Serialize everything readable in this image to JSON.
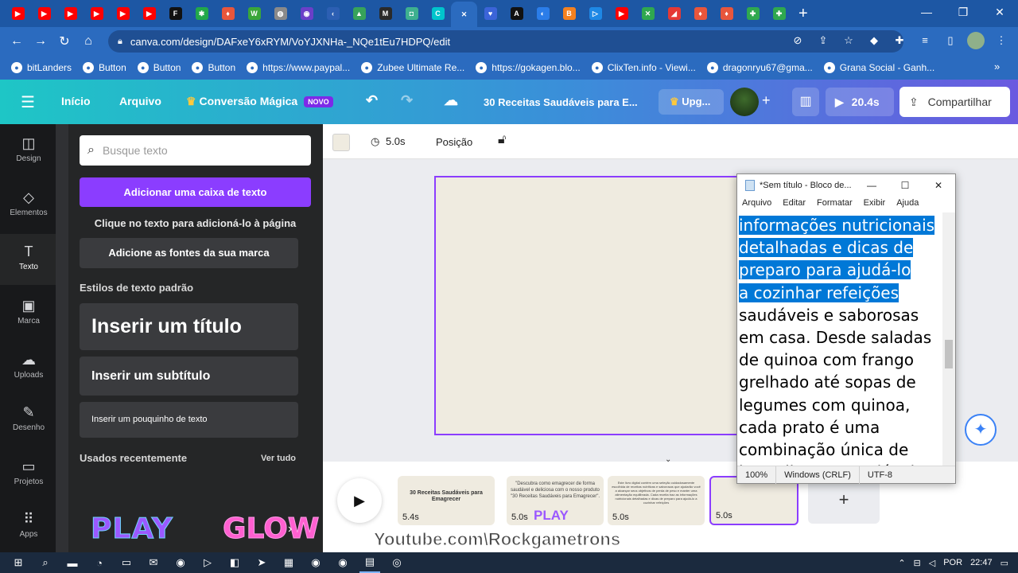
{
  "browser": {
    "tabs": [
      {
        "icon": "youtube-icon",
        "color": "#ff0000",
        "glyph": "▶"
      },
      {
        "icon": "youtube-icon",
        "color": "#ff0000",
        "glyph": "▶"
      },
      {
        "icon": "youtube-icon",
        "color": "#ff0000",
        "glyph": "▶"
      },
      {
        "icon": "youtube-icon",
        "color": "#ff0000",
        "glyph": "▶"
      },
      {
        "icon": "youtube-icon",
        "color": "#ff0000",
        "glyph": "▶"
      },
      {
        "icon": "youtube-icon",
        "color": "#ff0000",
        "glyph": "▶"
      },
      {
        "icon": "f-app-icon",
        "color": "#111111",
        "glyph": "F"
      },
      {
        "icon": "pinwheel-icon",
        "color": "#22a84a",
        "glyph": "✱"
      },
      {
        "icon": "drop-icon",
        "color": "#e8563c",
        "glyph": "♦"
      },
      {
        "icon": "w-app-icon",
        "color": "#3aa63a",
        "glyph": "W"
      },
      {
        "icon": "globe-icon",
        "color": "#8a8a8a",
        "glyph": "◍"
      },
      {
        "icon": "purple-circle-icon",
        "color": "#6b3fc8",
        "glyph": "◉"
      },
      {
        "icon": "arrow-app-icon",
        "color": "#2c5fb3",
        "glyph": "‹"
      },
      {
        "icon": "triangle-icon",
        "color": "#37a35a",
        "glyph": "▲"
      },
      {
        "icon": "m-app-icon",
        "color": "#2a2a2a",
        "glyph": "M"
      },
      {
        "icon": "rounded-app-icon",
        "color": "#3eb08f",
        "glyph": "◘"
      },
      {
        "icon": "canva-icon",
        "color": "#00c4cc",
        "glyph": "C"
      },
      {
        "icon": "close-icon",
        "color": "#2b6bbf",
        "glyph": "✕"
      },
      {
        "icon": "heart-app-icon",
        "color": "#3b64d8",
        "glyph": "♥"
      },
      {
        "icon": "a-app-icon",
        "color": "#111111",
        "glyph": "A"
      },
      {
        "icon": "half-circle-icon",
        "color": "#2b7de9",
        "glyph": "◐"
      },
      {
        "icon": "blogger-icon",
        "color": "#f48120",
        "glyph": "B"
      },
      {
        "icon": "play-app-icon",
        "color": "#1e88e5",
        "glyph": "▷"
      },
      {
        "icon": "youtube-icon",
        "color": "#ff0000",
        "glyph": "▶"
      },
      {
        "icon": "x-app-icon",
        "color": "#2fa84f",
        "glyph": "✕"
      },
      {
        "icon": "shield-app-icon",
        "color": "#e53935",
        "glyph": "◢"
      },
      {
        "icon": "drop-icon",
        "color": "#e8563c",
        "glyph": "♦"
      },
      {
        "icon": "drop-icon",
        "color": "#e8563c",
        "glyph": "♦"
      },
      {
        "icon": "puzzle-icon",
        "color": "#2fa84f",
        "glyph": "✚"
      },
      {
        "icon": "puzzle-icon",
        "color": "#2fa84f",
        "glyph": "✚"
      }
    ],
    "new_tab": "+",
    "url": "canva.com/design/DAFxeY6xRYM/VoYJXNHa-_NQe1tEu7HDPQ/edit",
    "bookmarks": [
      {
        "label": "bitLanders",
        "icon": "globe-icon"
      },
      {
        "label": "Button",
        "icon": "globe-icon"
      },
      {
        "label": "Button",
        "icon": "globe-icon"
      },
      {
        "label": "Button",
        "icon": "globe-icon"
      },
      {
        "label": "https://www.paypal...",
        "icon": "paypal-icon"
      },
      {
        "label": "Zubee Ultimate Re...",
        "icon": "zubee-icon"
      },
      {
        "label": "https://gokagen.blo...",
        "icon": "blogger-icon"
      },
      {
        "label": "ClixTen.info - Viewi...",
        "icon": "clixten-icon"
      },
      {
        "label": "dragonryu67@gma...",
        "icon": "google-icon"
      },
      {
        "label": "Grana Social - Ganh...",
        "icon": "grana-icon"
      }
    ]
  },
  "canva": {
    "header": {
      "home": "Início",
      "file": "Arquivo",
      "magic": "Conversão Mágica",
      "new_badge": "NOVO",
      "title": "30 Receitas Saudáveis para E...",
      "upgrade": "Upg...",
      "play_time": "20.4s",
      "share": "Compartilhar"
    },
    "rail": [
      {
        "label": "Design",
        "icon": "design-icon",
        "glyph": "◫"
      },
      {
        "label": "Elementos",
        "icon": "elements-icon",
        "glyph": "◇"
      },
      {
        "label": "Texto",
        "icon": "text-icon",
        "glyph": "T"
      },
      {
        "label": "Marca",
        "icon": "brand-icon",
        "glyph": "▣"
      },
      {
        "label": "Uploads",
        "icon": "upload-icon",
        "glyph": "☁"
      },
      {
        "label": "Desenho",
        "icon": "draw-icon",
        "glyph": "✎"
      },
      {
        "label": "Projetos",
        "icon": "folder-icon",
        "glyph": "▭"
      },
      {
        "label": "Apps",
        "icon": "apps-icon",
        "glyph": "⠿"
      }
    ],
    "panel": {
      "search_placeholder": "Busque texto",
      "add_textbox": "Adicionar uma caixa de texto",
      "hint": "Clique no texto para adicioná-lo à página",
      "brand_fonts": "Adicione as fontes da sua marca",
      "default_styles": "Estilos de texto padrão",
      "heading": "Inserir um título",
      "subheading": "Inserir um subtítulo",
      "body": "Inserir um pouquinho de texto",
      "recent": "Usados recentemente",
      "see_all": "Ver tudo",
      "recent_items": [
        "PLAY",
        "GLOW"
      ]
    },
    "toolbar": {
      "duration": "5.0s",
      "position": "Posição"
    },
    "timeline": {
      "pages": [
        {
          "duration": "5.4s",
          "text": "30 Receitas Saudáveis para Emagrecer"
        },
        {
          "duration": "5.0s",
          "text": "\"Descubra como emagrecer de forma saudável e deliciosa com o nosso produto \"30 Receitas Saudáveis para Emagrecer\".",
          "badge": "PLAY"
        },
        {
          "duration": "5.0s",
          "text": "Este livro digital contém uma seleção cuidadosamente escolhida de receitas nutritivas e saborosas que ajudarão você a alcançar seus objetivos de perda de peso e manter uma alimentação equilibrada. Cada receita traz as informações nutricionais detalhadas e dicas de preparo para ajudá-lo a cozinhar refeições"
        },
        {
          "duration": "5.0s",
          "text": ""
        }
      ],
      "add_page": "+"
    },
    "watermark": "Youtube.com\\Rockgametrons"
  },
  "notepad": {
    "title": "*Sem título - Bloco de...",
    "menu": [
      "Arquivo",
      "Editar",
      "Formatar",
      "Exibir",
      "Ajuda"
    ],
    "selected_text": [
      "informações nutricionais",
      "detalhadas e dicas de",
      "preparo para ajudá-lo",
      "a cozinhar refeições"
    ],
    "text_lines": [
      "saudáveis e saborosas",
      "em casa. Desde saladas",
      "de quinoa com frango",
      "grelhado até sopas de",
      "legumes com quinoa,",
      "cada prato é uma",
      "combinação única de",
      "ingredientes saudáveis e"
    ],
    "zoom": "100%",
    "line_endings": "Windows (CRLF)",
    "encoding": "UTF-8"
  },
  "taskbar": {
    "apps": [
      {
        "icon": "windows-start-icon",
        "glyph": "⊞"
      },
      {
        "icon": "search-icon",
        "glyph": "⌕"
      },
      {
        "icon": "file-explorer-icon",
        "glyph": "▬"
      },
      {
        "icon": "edge-icon",
        "glyph": "◔"
      },
      {
        "icon": "explorer-folder-icon",
        "glyph": "▭"
      },
      {
        "icon": "mail-icon",
        "glyph": "✉"
      },
      {
        "icon": "chrome-icon",
        "glyph": "◉"
      },
      {
        "icon": "app-icon",
        "glyph": "▷"
      },
      {
        "icon": "app-icon",
        "glyph": "◧"
      },
      {
        "icon": "telegram-icon",
        "glyph": "➤"
      },
      {
        "icon": "clapper-icon",
        "glyph": "▦"
      },
      {
        "icon": "chrome-icon",
        "glyph": "◉"
      },
      {
        "icon": "chrome-icon",
        "glyph": "◉"
      },
      {
        "icon": "notepad-icon",
        "glyph": "▤"
      },
      {
        "icon": "obs-icon",
        "glyph": "◎"
      }
    ],
    "language": "POR",
    "time": "22:47"
  },
  "colors": {
    "accent": "#8b3dff",
    "page_bg": "#efebe0",
    "browser_blue": "#2b6bbf"
  }
}
